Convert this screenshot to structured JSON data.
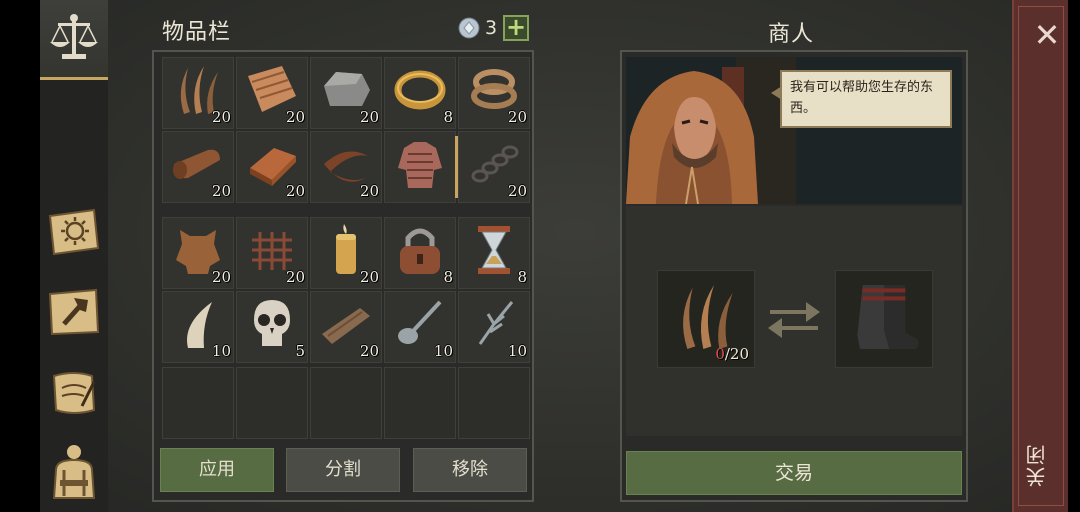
{
  "sidebar": {
    "tabs": [
      {
        "icon": "scales-icon",
        "active": true
      },
      {
        "icon": "sun-book-icon",
        "active": false
      },
      {
        "icon": "hammer-map-icon",
        "active": false
      },
      {
        "icon": "quill-scroll-icon",
        "active": false
      },
      {
        "icon": "backpack-character-icon",
        "active": false
      }
    ]
  },
  "inventory": {
    "title": "物品栏",
    "gem_count": "3",
    "add_label": "+",
    "groups": [
      [
        {
          "item": "fiber",
          "qty": "20"
        },
        {
          "item": "cloth",
          "qty": "20"
        },
        {
          "item": "stone",
          "qty": "20"
        },
        {
          "item": "ring",
          "qty": "8"
        },
        {
          "item": "rope",
          "qty": "20"
        },
        {
          "item": "leather-roll",
          "qty": "20"
        },
        {
          "item": "copper-ingot",
          "qty": "20"
        },
        {
          "item": "leather-strap",
          "qty": "20"
        },
        {
          "item": "chainmail",
          "qty": ""
        },
        {
          "item": "chain",
          "qty": "20"
        }
      ],
      [
        {
          "item": "hide",
          "qty": "20"
        },
        {
          "item": "net",
          "qty": "20"
        },
        {
          "item": "candle",
          "qty": "20"
        },
        {
          "item": "padlock",
          "qty": "8"
        },
        {
          "item": "hourglass",
          "qty": "8"
        },
        {
          "item": "fang",
          "qty": "10"
        },
        {
          "item": "skull",
          "qty": "5"
        },
        {
          "item": "plank",
          "qty": "20"
        },
        {
          "item": "spoon",
          "qty": "10"
        },
        {
          "item": "fork",
          "qty": "10"
        }
      ],
      [
        {
          "item": "",
          "qty": ""
        },
        {
          "item": "",
          "qty": ""
        },
        {
          "item": "",
          "qty": ""
        },
        {
          "item": "",
          "qty": ""
        },
        {
          "item": "",
          "qty": ""
        }
      ]
    ],
    "buttons": {
      "use": "应用",
      "split": "分割",
      "remove": "移除"
    }
  },
  "merchant": {
    "title": "商人",
    "speech": "我有可以帮助您生存的东西。",
    "trade": {
      "give_item": "fiber",
      "give_have": "0",
      "give_need": "/20",
      "receive_item": "boots"
    },
    "trade_button": "交易"
  },
  "close": {
    "x_label": "✕",
    "label": "关闭"
  },
  "colors": {
    "accent_gold": "#c7a762",
    "button_green": "#576c43",
    "close_red": "#5b2f2b",
    "qty_short_red": "#e0504a"
  }
}
